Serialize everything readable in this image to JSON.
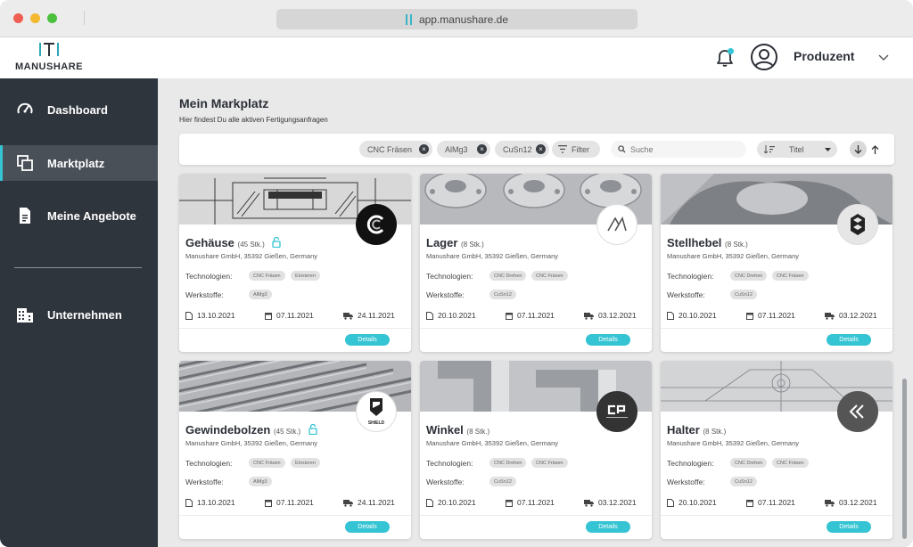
{
  "browser": {
    "url": "app.manushare.de"
  },
  "header": {
    "brand": "MANUSHARE",
    "role": "Produzent"
  },
  "sidebar": {
    "items": [
      {
        "label": "Dashboard",
        "icon": "speedometer-icon"
      },
      {
        "label": "Marktplatz",
        "icon": "copy-stack-icon"
      },
      {
        "label": "Meine Angebote",
        "icon": "document-icon"
      },
      {
        "label": "Unternehmen",
        "icon": "building-icon"
      }
    ],
    "active": "Marktplatz"
  },
  "main": {
    "title": "Mein Markplatz",
    "subtitle": "Hier findest Du alle aktiven Fertigungsanfragen",
    "filters": {
      "chips": [
        "CNC Fräsen",
        "AlMg3",
        "CuSn12"
      ],
      "filter_label": "Filter",
      "search_placeholder": "Suche",
      "sort_label": "Titel"
    },
    "cards": [
      {
        "title": "Gehäuse",
        "qty": "(45 Stk.)",
        "locked": true,
        "address": "Manushare GmbH, 35392 Gießen, Germany",
        "tech_label": "Technologien:",
        "technologies": [
          "CNC Fräsen",
          "Eloxieren"
        ],
        "mat_label": "Werkstoffe:",
        "materials": [
          "AlMg3"
        ],
        "date_created": "13.10.2021",
        "date_deadline": "07.11.2021",
        "date_delivery": "24.11.2021",
        "details": "Details",
        "logo": "c-logo-icon",
        "image": "drawing"
      },
      {
        "title": "Lager",
        "qty": "(8 Stk.)",
        "locked": false,
        "address": "Manushare GmbH, 35392 Gießen, Germany",
        "tech_label": "Technologien:",
        "technologies": [
          "CNC Drehen",
          "CNC Fräsen"
        ],
        "mat_label": "Werkstoffe:",
        "materials": [
          "CuSn12"
        ],
        "date_created": "20.10.2021",
        "date_deadline": "07.11.2021",
        "date_delivery": "03.12.2021",
        "details": "Details",
        "logo": "triangle-logo-icon",
        "image": "flanges"
      },
      {
        "title": "Stellhebel",
        "qty": "(8 Stk.)",
        "locked": false,
        "address": "Manushare GmbH, 35392 Gießen, Germany",
        "tech_label": "Technologien:",
        "technologies": [
          "CNC Drehen",
          "CNC Fräsen"
        ],
        "mat_label": "Werkstoffe:",
        "materials": [
          "CuSn12"
        ],
        "date_created": "20.10.2021",
        "date_deadline": "07.11.2021",
        "date_delivery": "03.12.2021",
        "details": "Details",
        "logo": "hex-logo-icon",
        "image": "lever"
      },
      {
        "title": "Gewindebolzen",
        "qty": "(45 Stk.)",
        "locked": true,
        "address": "Manushare GmbH, 35392 Gießen, Germany",
        "tech_label": "Technologien:",
        "technologies": [
          "CNC Fräsen",
          "Eloxieren"
        ],
        "mat_label": "Werkstoffe:",
        "materials": [
          "AlMg3"
        ],
        "date_created": "13.10.2021",
        "date_deadline": "07.11.2021",
        "date_delivery": "24.11.2021",
        "details": "Details",
        "logo": "shield-logo-icon",
        "logo_text": "SHIELD",
        "image": "bolts"
      },
      {
        "title": "Winkel",
        "qty": "(8 Stk.)",
        "locked": false,
        "address": "Manushare GmbH, 35392 Gießen, Germany",
        "tech_label": "Technologien:",
        "technologies": [
          "CNC Drehen",
          "CNC Fräsen"
        ],
        "mat_label": "Werkstoffe:",
        "materials": [
          "CuSn12"
        ],
        "date_created": "20.10.2021",
        "date_deadline": "07.11.2021",
        "date_delivery": "03.12.2021",
        "details": "Details",
        "logo": "cp-logo-icon",
        "image": "brackets"
      },
      {
        "title": "Halter",
        "qty": "(8 Stk.)",
        "locked": false,
        "address": "Manushare GmbH, 35392 Gießen, Germany",
        "tech_label": "Technologien:",
        "technologies": [
          "CNC Drehen",
          "CNC Fräsen"
        ],
        "mat_label": "Werkstoffe:",
        "materials": [
          "CuSn12"
        ],
        "date_created": "20.10.2021",
        "date_deadline": "07.11.2021",
        "date_delivery": "03.12.2021",
        "details": "Details",
        "logo": "chevrons-logo-icon",
        "image": "sketch"
      }
    ]
  },
  "colors": {
    "accent": "#35c4d3",
    "sidebar": "#2f353c",
    "sidebar_active": "#4a5058"
  }
}
